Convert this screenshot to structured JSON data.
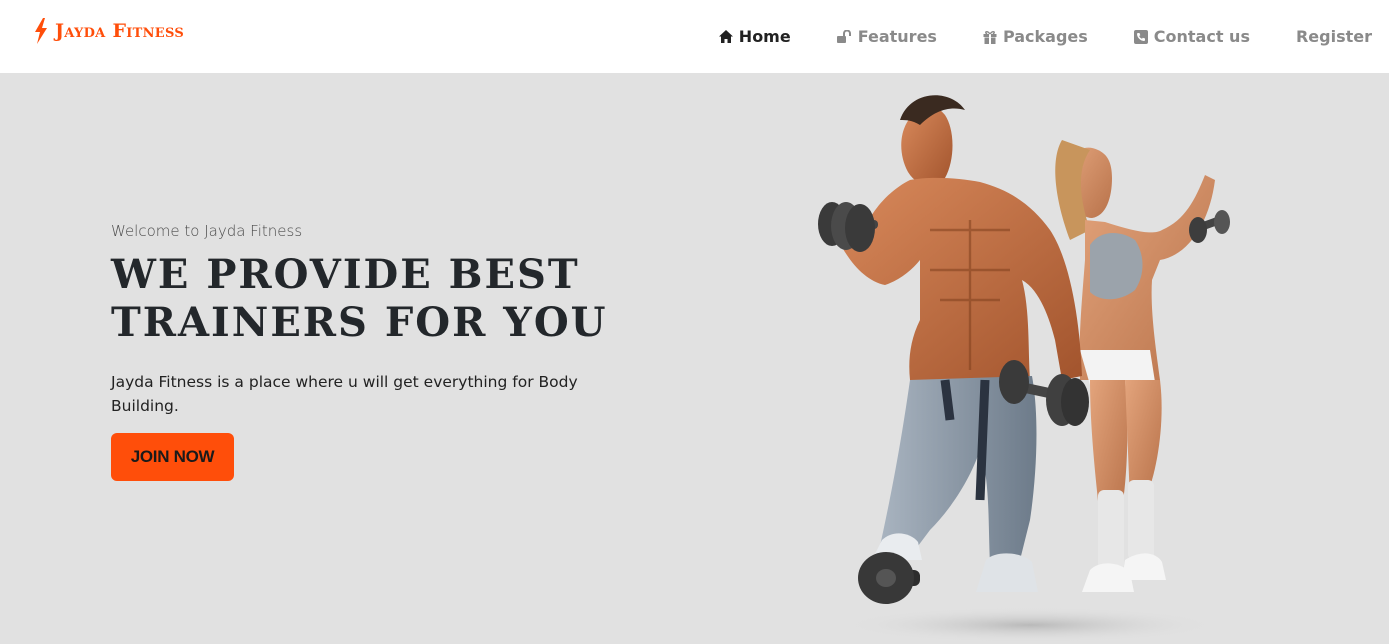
{
  "brand": {
    "name": "Jayda Fitness",
    "color": "#ff4e0a",
    "icon": "bolt-icon"
  },
  "nav": {
    "items": [
      {
        "label": "Home",
        "icon": "home-icon",
        "active": true
      },
      {
        "label": "Features",
        "icon": "unlock-icon",
        "active": false
      },
      {
        "label": "Packages",
        "icon": "gift-icon",
        "active": false
      },
      {
        "label": "Contact us",
        "icon": "phone-icon",
        "active": false
      },
      {
        "label": "Register",
        "icon": "",
        "active": false
      }
    ]
  },
  "hero": {
    "subtitle": "Welcome to Jayda Fitness",
    "title": "WE PROVIDE BEST TRAINERS FOR YOU",
    "description": "Jayda Fitness is a place where u will get everything for Body Building.",
    "cta_label": "JOIN NOW",
    "image": "fitness-couple-with-dumbbells-image"
  },
  "colors": {
    "accent": "#ff4e0a",
    "background": "#e1e1e1",
    "navbar": "#ffffff"
  }
}
